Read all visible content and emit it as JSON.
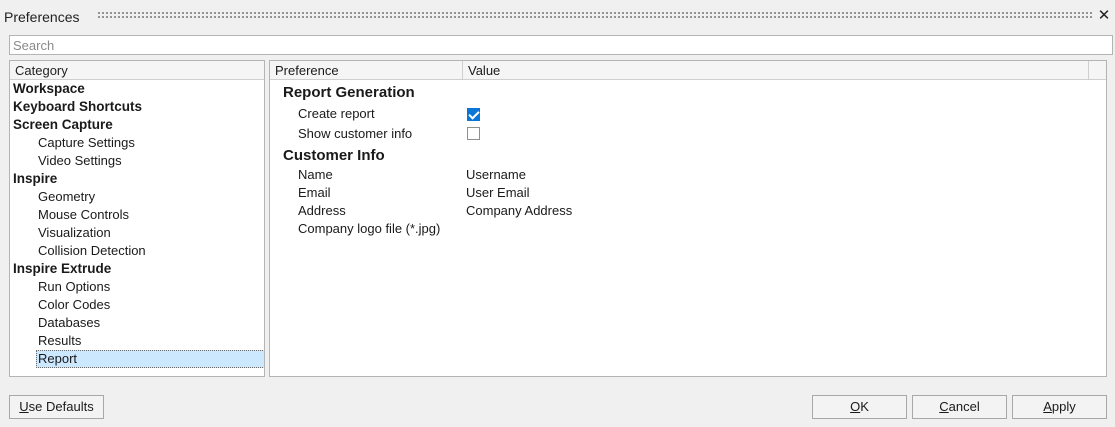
{
  "window": {
    "title": "Preferences"
  },
  "search": {
    "placeholder": "Search",
    "value": ""
  },
  "categories": {
    "header": "Category",
    "items": [
      {
        "label": "Workspace",
        "level": 0
      },
      {
        "label": "Keyboard Shortcuts",
        "level": 0
      },
      {
        "label": "Screen Capture",
        "level": 0
      },
      {
        "label": "Capture Settings",
        "level": 1
      },
      {
        "label": "Video Settings",
        "level": 1
      },
      {
        "label": "Inspire",
        "level": 0
      },
      {
        "label": "Geometry",
        "level": 1
      },
      {
        "label": "Mouse Controls",
        "level": 1
      },
      {
        "label": "Visualization",
        "level": 1
      },
      {
        "label": "Collision Detection",
        "level": 1
      },
      {
        "label": "Inspire Extrude",
        "level": 0
      },
      {
        "label": "Run Options",
        "level": 1
      },
      {
        "label": "Color Codes",
        "level": 1
      },
      {
        "label": "Databases",
        "level": 1
      },
      {
        "label": "Results",
        "level": 1
      },
      {
        "label": "Report",
        "level": 1,
        "selected": true
      }
    ]
  },
  "preferences": {
    "col_preference": "Preference",
    "col_value": "Value",
    "report_generation": {
      "title": "Report Generation",
      "create_report": {
        "label": "Create report",
        "checked": true
      },
      "show_customer_info": {
        "label": "Show customer info",
        "checked": false
      }
    },
    "customer_info": {
      "title": "Customer Info",
      "name": {
        "label": "Name",
        "value": "Username"
      },
      "email": {
        "label": "Email",
        "value": "User Email"
      },
      "address": {
        "label": "Address",
        "value": "Company Address"
      },
      "logo": {
        "label": "Company logo file (*.jpg)",
        "value": ""
      }
    }
  },
  "buttons": {
    "use_defaults": {
      "mnemonic": "U",
      "rest": "se Defaults"
    },
    "ok": {
      "mnemonic": "O",
      "rest": "K"
    },
    "cancel": {
      "mnemonic": "C",
      "rest": "ancel"
    },
    "apply": {
      "mnemonic": "A",
      "rest": "pply"
    }
  },
  "colors": {
    "accent": "#0a76d8",
    "selection": "#cce8ff"
  }
}
